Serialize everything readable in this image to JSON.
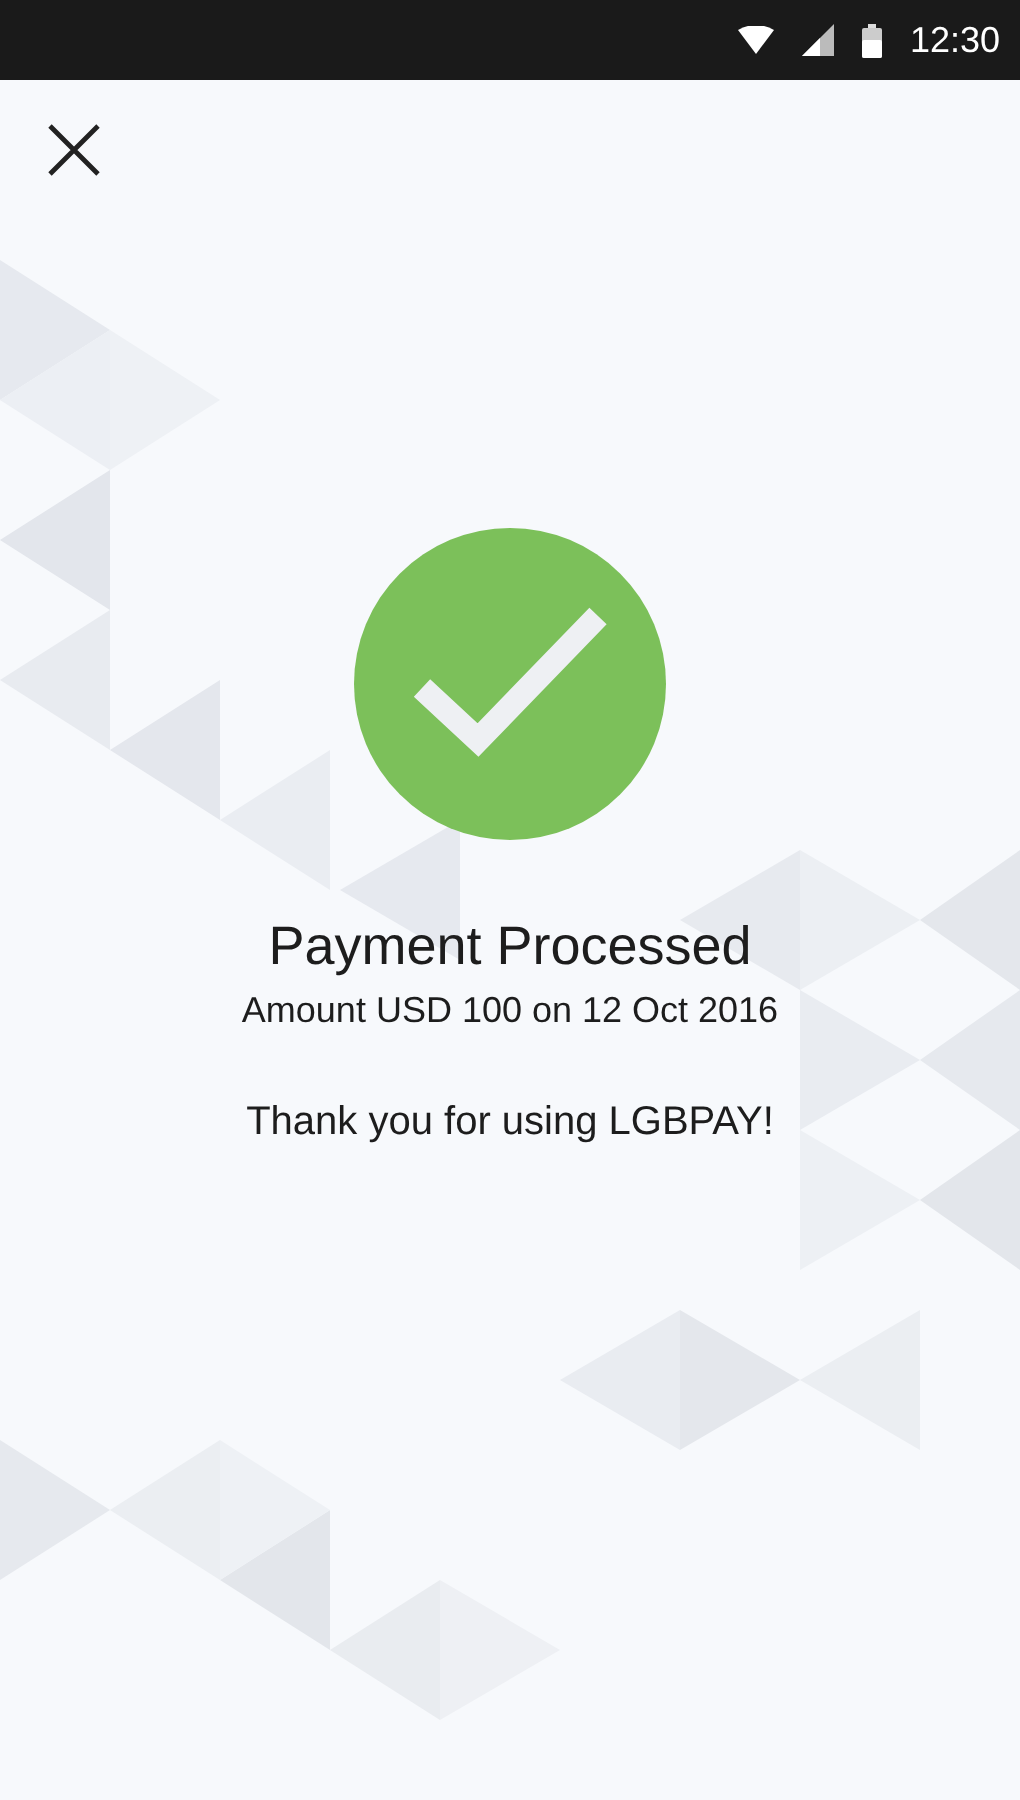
{
  "status_bar": {
    "time": "12:30"
  },
  "result": {
    "title": "Payment Processed",
    "details": "Amount USD 100 on 12 Oct 2016",
    "thanks": "Thank you for using LGBPAY!"
  }
}
